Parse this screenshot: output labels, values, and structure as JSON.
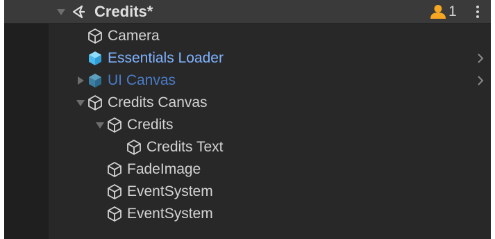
{
  "scene": {
    "title": "Credits*",
    "user_count": "1"
  },
  "hierarchy": {
    "items": [
      {
        "label": "Camera",
        "color": "#d4d4d4"
      },
      {
        "label": "Essentials Loader",
        "color": "#7fb3ff"
      },
      {
        "label": "UI Canvas",
        "color": "#4a7cc8"
      },
      {
        "label": "Credits Canvas",
        "color": "#d4d4d4"
      },
      {
        "label": "Credits",
        "color": "#d4d4d4"
      },
      {
        "label": "Credits Text",
        "color": "#d4d4d4"
      },
      {
        "label": "FadeImage",
        "color": "#d4d4d4"
      },
      {
        "label": "EventSystem",
        "color": "#d4d4d4"
      },
      {
        "label": "EventSystem",
        "color": "#d4d4d4"
      }
    ]
  },
  "colors": {
    "background": "#282828",
    "gutter": "#1f1f1f",
    "header": "#3a3a3a",
    "prefab_blue": "#5bc8f5",
    "user_orange": "#f5a623"
  },
  "icons": {
    "scene": "unity-scene-icon",
    "gameobject": "cube-outline-icon",
    "prefab": "prefab-cube-icon",
    "user": "user-icon",
    "menu": "kebab-menu-icon",
    "expand": "chevron-right-icon"
  }
}
